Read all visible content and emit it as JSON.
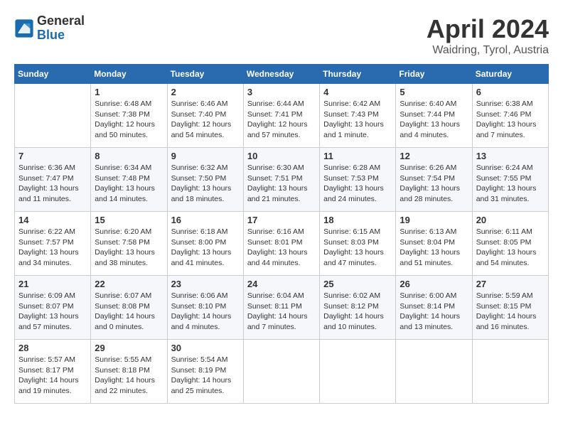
{
  "header": {
    "logo_general": "General",
    "logo_blue": "Blue",
    "month_title": "April 2024",
    "subtitle": "Waidring, Tyrol, Austria"
  },
  "calendar": {
    "days_of_week": [
      "Sunday",
      "Monday",
      "Tuesday",
      "Wednesday",
      "Thursday",
      "Friday",
      "Saturday"
    ],
    "weeks": [
      [
        {
          "day": "",
          "info": ""
        },
        {
          "day": "1",
          "info": "Sunrise: 6:48 AM\nSunset: 7:38 PM\nDaylight: 12 hours\nand 50 minutes."
        },
        {
          "day": "2",
          "info": "Sunrise: 6:46 AM\nSunset: 7:40 PM\nDaylight: 12 hours\nand 54 minutes."
        },
        {
          "day": "3",
          "info": "Sunrise: 6:44 AM\nSunset: 7:41 PM\nDaylight: 12 hours\nand 57 minutes."
        },
        {
          "day": "4",
          "info": "Sunrise: 6:42 AM\nSunset: 7:43 PM\nDaylight: 13 hours\nand 1 minute."
        },
        {
          "day": "5",
          "info": "Sunrise: 6:40 AM\nSunset: 7:44 PM\nDaylight: 13 hours\nand 4 minutes."
        },
        {
          "day": "6",
          "info": "Sunrise: 6:38 AM\nSunset: 7:46 PM\nDaylight: 13 hours\nand 7 minutes."
        }
      ],
      [
        {
          "day": "7",
          "info": "Sunrise: 6:36 AM\nSunset: 7:47 PM\nDaylight: 13 hours\nand 11 minutes."
        },
        {
          "day": "8",
          "info": "Sunrise: 6:34 AM\nSunset: 7:48 PM\nDaylight: 13 hours\nand 14 minutes."
        },
        {
          "day": "9",
          "info": "Sunrise: 6:32 AM\nSunset: 7:50 PM\nDaylight: 13 hours\nand 18 minutes."
        },
        {
          "day": "10",
          "info": "Sunrise: 6:30 AM\nSunset: 7:51 PM\nDaylight: 13 hours\nand 21 minutes."
        },
        {
          "day": "11",
          "info": "Sunrise: 6:28 AM\nSunset: 7:53 PM\nDaylight: 13 hours\nand 24 minutes."
        },
        {
          "day": "12",
          "info": "Sunrise: 6:26 AM\nSunset: 7:54 PM\nDaylight: 13 hours\nand 28 minutes."
        },
        {
          "day": "13",
          "info": "Sunrise: 6:24 AM\nSunset: 7:55 PM\nDaylight: 13 hours\nand 31 minutes."
        }
      ],
      [
        {
          "day": "14",
          "info": "Sunrise: 6:22 AM\nSunset: 7:57 PM\nDaylight: 13 hours\nand 34 minutes."
        },
        {
          "day": "15",
          "info": "Sunrise: 6:20 AM\nSunset: 7:58 PM\nDaylight: 13 hours\nand 38 minutes."
        },
        {
          "day": "16",
          "info": "Sunrise: 6:18 AM\nSunset: 8:00 PM\nDaylight: 13 hours\nand 41 minutes."
        },
        {
          "day": "17",
          "info": "Sunrise: 6:16 AM\nSunset: 8:01 PM\nDaylight: 13 hours\nand 44 minutes."
        },
        {
          "day": "18",
          "info": "Sunrise: 6:15 AM\nSunset: 8:03 PM\nDaylight: 13 hours\nand 47 minutes."
        },
        {
          "day": "19",
          "info": "Sunrise: 6:13 AM\nSunset: 8:04 PM\nDaylight: 13 hours\nand 51 minutes."
        },
        {
          "day": "20",
          "info": "Sunrise: 6:11 AM\nSunset: 8:05 PM\nDaylight: 13 hours\nand 54 minutes."
        }
      ],
      [
        {
          "day": "21",
          "info": "Sunrise: 6:09 AM\nSunset: 8:07 PM\nDaylight: 13 hours\nand 57 minutes."
        },
        {
          "day": "22",
          "info": "Sunrise: 6:07 AM\nSunset: 8:08 PM\nDaylight: 14 hours\nand 0 minutes."
        },
        {
          "day": "23",
          "info": "Sunrise: 6:06 AM\nSunset: 8:10 PM\nDaylight: 14 hours\nand 4 minutes."
        },
        {
          "day": "24",
          "info": "Sunrise: 6:04 AM\nSunset: 8:11 PM\nDaylight: 14 hours\nand 7 minutes."
        },
        {
          "day": "25",
          "info": "Sunrise: 6:02 AM\nSunset: 8:12 PM\nDaylight: 14 hours\nand 10 minutes."
        },
        {
          "day": "26",
          "info": "Sunrise: 6:00 AM\nSunset: 8:14 PM\nDaylight: 14 hours\nand 13 minutes."
        },
        {
          "day": "27",
          "info": "Sunrise: 5:59 AM\nSunset: 8:15 PM\nDaylight: 14 hours\nand 16 minutes."
        }
      ],
      [
        {
          "day": "28",
          "info": "Sunrise: 5:57 AM\nSunset: 8:17 PM\nDaylight: 14 hours\nand 19 minutes."
        },
        {
          "day": "29",
          "info": "Sunrise: 5:55 AM\nSunset: 8:18 PM\nDaylight: 14 hours\nand 22 minutes."
        },
        {
          "day": "30",
          "info": "Sunrise: 5:54 AM\nSunset: 8:19 PM\nDaylight: 14 hours\nand 25 minutes."
        },
        {
          "day": "",
          "info": ""
        },
        {
          "day": "",
          "info": ""
        },
        {
          "day": "",
          "info": ""
        },
        {
          "day": "",
          "info": ""
        }
      ]
    ]
  }
}
